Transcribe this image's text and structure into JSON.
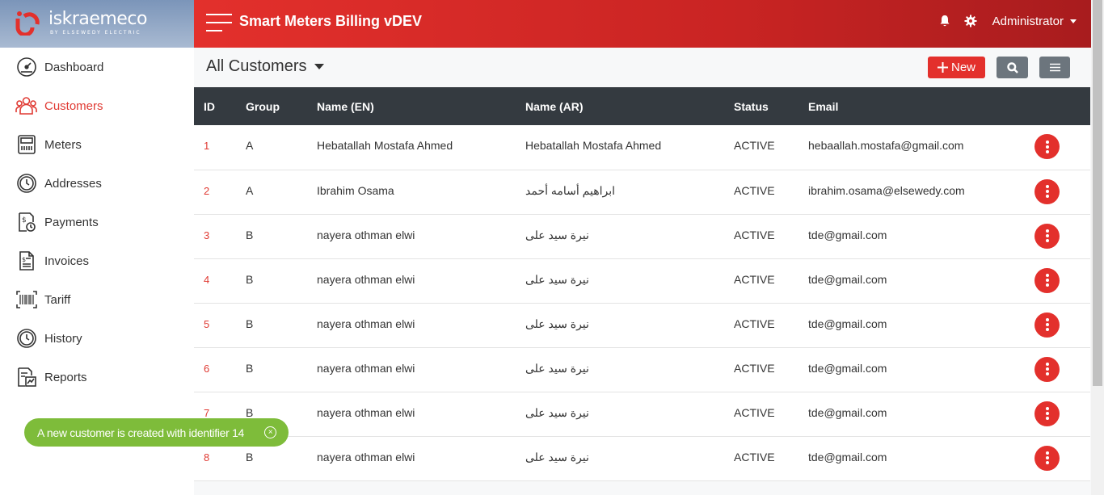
{
  "brand": {
    "name": "iskraemeco",
    "sub": "BY ELSEWEDY ELECTRIC"
  },
  "app": {
    "title": "Smart Meters Billing vDEV",
    "user": "Administrator"
  },
  "colors": {
    "accent": "#e3302c",
    "header_dark": "#343a40",
    "toast_green": "#7ebc3a"
  },
  "sidebar": {
    "items": [
      {
        "label": "Dashboard",
        "icon": "dashboard-gauge-icon"
      },
      {
        "label": "Customers",
        "icon": "customers-group-icon",
        "active": true
      },
      {
        "label": "Meters",
        "icon": "meter-icon"
      },
      {
        "label": "Addresses",
        "icon": "clock-arrow-icon"
      },
      {
        "label": "Payments",
        "icon": "payment-doc-icon"
      },
      {
        "label": "Invoices",
        "icon": "invoice-icon"
      },
      {
        "label": "Tariff",
        "icon": "barcode-icon"
      },
      {
        "label": "History",
        "icon": "history-icon"
      },
      {
        "label": "Reports",
        "icon": "report-chart-icon"
      }
    ]
  },
  "page": {
    "title": "All Customers",
    "new_label": "New"
  },
  "table": {
    "headers": [
      "ID",
      "Group",
      "Name (EN)",
      "Name (AR)",
      "Status",
      "Email"
    ],
    "rows": [
      {
        "id": "1",
        "group": "A",
        "name_en": "Hebatallah Mostafa Ahmed",
        "name_ar": "Hebatallah Mostafa Ahmed",
        "status": "ACTIVE",
        "email": "hebaallah.mostafa@gmail.com"
      },
      {
        "id": "2",
        "group": "A",
        "name_en": "Ibrahim Osama",
        "name_ar": "ابراهيم أسامه أحمد",
        "status": "ACTIVE",
        "email": "ibrahim.osama@elsewedy.com"
      },
      {
        "id": "3",
        "group": "B",
        "name_en": "nayera othman elwi",
        "name_ar": "نيرة سيد على",
        "status": "ACTIVE",
        "email": "tde@gmail.com"
      },
      {
        "id": "4",
        "group": "B",
        "name_en": "nayera othman elwi",
        "name_ar": "نيرة سيد على",
        "status": "ACTIVE",
        "email": "tde@gmail.com"
      },
      {
        "id": "5",
        "group": "B",
        "name_en": "nayera othman elwi",
        "name_ar": "نيرة سيد على",
        "status": "ACTIVE",
        "email": "tde@gmail.com"
      },
      {
        "id": "6",
        "group": "B",
        "name_en": "nayera othman elwi",
        "name_ar": "نيرة سيد على",
        "status": "ACTIVE",
        "email": "tde@gmail.com"
      },
      {
        "id": "7",
        "group": "B",
        "name_en": "nayera othman elwi",
        "name_ar": "نيرة سيد على",
        "status": "ACTIVE",
        "email": "tde@gmail.com"
      },
      {
        "id": "8",
        "group": "B",
        "name_en": "nayera othman elwi",
        "name_ar": "نيرة سيد على",
        "status": "ACTIVE",
        "email": "tde@gmail.com"
      }
    ]
  },
  "toast": {
    "message": "A new customer is created with identifier 14"
  }
}
